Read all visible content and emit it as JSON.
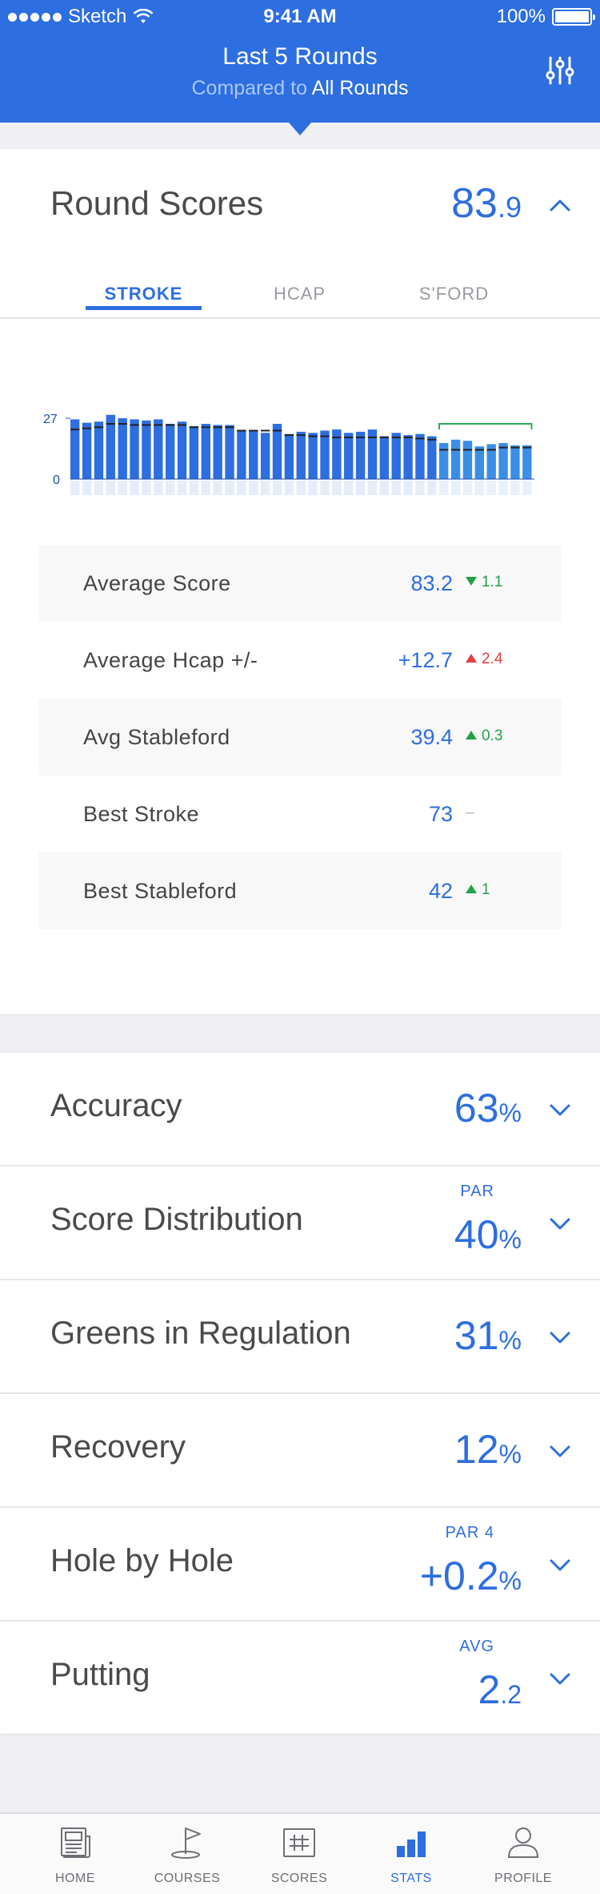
{
  "status_bar": {
    "carrier": "Sketch",
    "time": "9:41 AM",
    "battery": "100%"
  },
  "header": {
    "title": "Last 5 Rounds",
    "subtitle_prefix": "Compared to",
    "subtitle_emphasis": "All Rounds",
    "filter_icon": "sliders-icon"
  },
  "round_scores": {
    "title": "Round Scores",
    "value_main": "83",
    "value_decimal": ".9",
    "tabs": [
      "STROKE",
      "HCAP",
      "S'FORD"
    ],
    "active_tab": "STROKE",
    "stats": [
      {
        "label": "Average Score",
        "value": "83.2",
        "delta": "1.1",
        "direction": "down"
      },
      {
        "label": "Average Hcap +/-",
        "value": "+12.7",
        "delta": "2.4",
        "direction": "up-bad"
      },
      {
        "label": "Avg Stableford",
        "value": "39.4",
        "delta": "0.3",
        "direction": "up"
      },
      {
        "label": "Best Stroke",
        "value": "73",
        "delta": "–",
        "direction": "none"
      },
      {
        "label": "Best Stableford",
        "value": "42",
        "delta": "1",
        "direction": "up"
      }
    ]
  },
  "chart_data": {
    "type": "bar",
    "y_tick_labels": [
      "27",
      "0"
    ],
    "ylim": [
      0,
      27
    ],
    "values": [
      26.5,
      25,
      25.5,
      28.5,
      27,
      26.5,
      26,
      26.5,
      24.5,
      25.5,
      23.5,
      24.5,
      24,
      24,
      21.5,
      21.5,
      20.5,
      24.5,
      20,
      21,
      20.5,
      21.5,
      22,
      20.5,
      21,
      22,
      19,
      20.5,
      19.5,
      20,
      19,
      16,
      17.5,
      17,
      14.5,
      15.5,
      16,
      15,
      15
    ],
    "avg_markers": [
      22,
      22.5,
      23,
      24.5,
      24.5,
      24,
      24,
      24,
      24,
      24,
      23,
      23,
      23,
      23,
      21.5,
      21.5,
      21.5,
      21.5,
      19.5,
      19.5,
      19,
      19,
      18.5,
      18.5,
      18.5,
      18.5,
      18.5,
      18.5,
      18.5,
      18,
      17.5,
      13,
      13,
      13,
      13,
      13,
      14,
      14,
      14
    ],
    "highlight_last": 8,
    "colors": {
      "bar": "#2d6ee0",
      "bar_recent": "#3a8ee8",
      "marker": "#222222",
      "bracket": "#2ca85a"
    }
  },
  "sections": [
    {
      "title": "Accuracy",
      "value_main": "63",
      "value_unit": "%",
      "kicker": ""
    },
    {
      "title": "Score Distribution",
      "value_main": "40",
      "value_unit": "%",
      "kicker": "PAR"
    },
    {
      "title": "Greens in Regulation",
      "value_main": "31",
      "value_unit": "%",
      "kicker": ""
    },
    {
      "title": "Recovery",
      "value_main": "12",
      "value_unit": "%",
      "kicker": ""
    },
    {
      "title": "Hole by Hole",
      "value_main": "+0.2",
      "value_unit": "%",
      "kicker": "PAR 4"
    },
    {
      "title": "Putting",
      "value_main": "2",
      "value_unit": ".2",
      "kicker": "AVG"
    }
  ],
  "tabbar": [
    {
      "label": "HOME",
      "icon": "home-newspaper-icon"
    },
    {
      "label": "COURSES",
      "icon": "flag-icon"
    },
    {
      "label": "SCORES",
      "icon": "scorecard-icon"
    },
    {
      "label": "STATS",
      "icon": "bar-chart-icon",
      "active": true
    },
    {
      "label": "PROFILE",
      "icon": "person-icon"
    }
  ]
}
